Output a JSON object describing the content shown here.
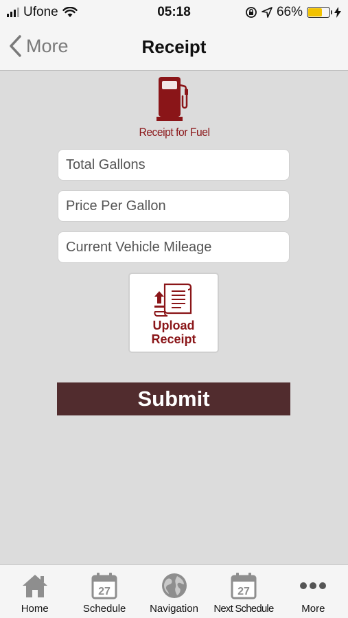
{
  "status_bar": {
    "carrier": "Ufone",
    "time": "05:18",
    "battery": "66%",
    "battery_level": 0.66,
    "icons": [
      "signal-icon",
      "wifi-icon",
      "orientation-lock-icon",
      "location-arrow-icon",
      "battery-icon",
      "charging-bolt-icon"
    ]
  },
  "nav": {
    "back_label": "More",
    "title": "Receipt"
  },
  "hero": {
    "icon": "fuel-pump-icon",
    "caption": "Receipt for Fuel"
  },
  "form": {
    "total_gallons_placeholder": "Total Gallons",
    "price_per_gallon_placeholder": "Price Per Gallon",
    "vehicle_mileage_placeholder": "Current Vehicle Mileage",
    "upload_label_line1": "Upload",
    "upload_label_line2": "Receipt",
    "submit_label": "Submit"
  },
  "tabs": [
    {
      "label": "Home",
      "icon": "home-icon"
    },
    {
      "label": "Schedule",
      "icon": "calendar-icon",
      "badge": "27"
    },
    {
      "label": "Navigation",
      "icon": "globe-icon"
    },
    {
      "label": "Next Schedule",
      "icon": "calendar-icon",
      "badge": "27"
    },
    {
      "label": "More",
      "icon": "more-dots-icon"
    }
  ],
  "colors": {
    "accent": "#8a1518",
    "submit_bg": "#512c2e",
    "background": "#dcdcdc",
    "tab_icon": "#8e8e8e"
  }
}
